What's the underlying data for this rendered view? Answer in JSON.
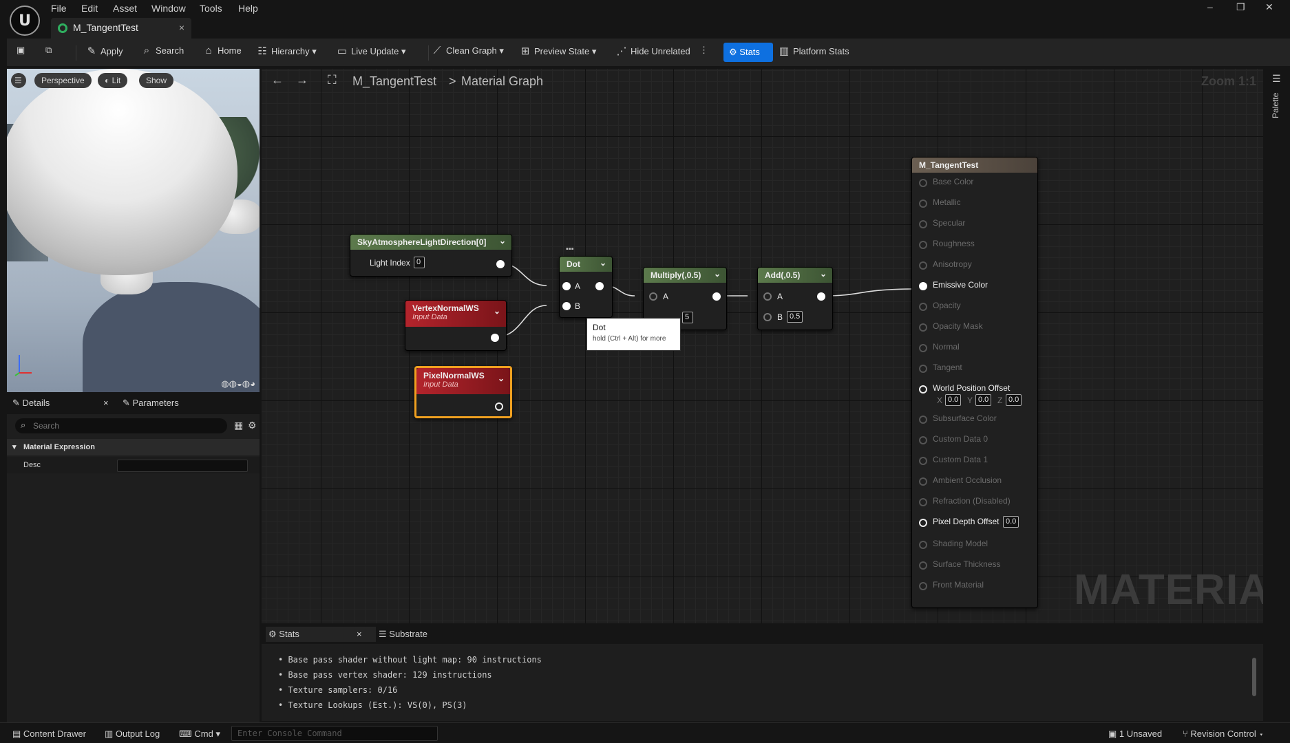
{
  "menu": [
    "File",
    "Edit",
    "Asset",
    "Window",
    "Tools",
    "Help"
  ],
  "tab": {
    "title": "M_TangentTest",
    "close": "×"
  },
  "window_controls": {
    "min": "–",
    "max": "❐",
    "close": "✕"
  },
  "toolbar": {
    "apply": "Apply",
    "search": "Search",
    "home": "Home",
    "hierarchy": "Hierarchy",
    "live_update": "Live Update",
    "clean_graph": "Clean Graph",
    "preview_state": "Preview State",
    "hide_unrelated": "Hide Unrelated",
    "stats": "Stats",
    "platform_stats": "Platform Stats"
  },
  "viewport": {
    "perspective": "Perspective",
    "lit": "Lit",
    "show": "Show"
  },
  "details": {
    "tab_details": "Details",
    "tab_parameters": "Parameters",
    "search_placeholder": "Search",
    "section": "Material Expression",
    "desc_label": "Desc",
    "desc_value": ""
  },
  "graph": {
    "crumb_asset": "M_TangentTest",
    "crumb_sep": ">",
    "crumb_graph": "Material Graph",
    "zoom": "Zoom 1:1",
    "watermark": "MATERIAL"
  },
  "nodes": {
    "sky": {
      "title": "SkyAtmosphereLightDirection[0]",
      "pin": "Light Index",
      "value": "0"
    },
    "vertex": {
      "title": "VertexNormalWS",
      "subtitle": "Input Data"
    },
    "pixel": {
      "title": "PixelNormalWS",
      "subtitle": "Input Data"
    },
    "dot": {
      "title": "Dot",
      "a": "A",
      "b": "B"
    },
    "multiply": {
      "title": "Multiply(,0.5)",
      "a": "A",
      "b_value": "5"
    },
    "add": {
      "title": "Add(,0.5)",
      "a": "A",
      "b": "B",
      "b_value": "0.5"
    }
  },
  "tooltip": {
    "title": "Dot",
    "hint": "hold (Ctrl + Alt) for more"
  },
  "material_node": {
    "title": "M_TangentTest",
    "inputs": [
      "Base Color",
      "Metallic",
      "Specular",
      "Roughness",
      "Anisotropy",
      "Emissive Color",
      "Opacity",
      "Opacity Mask",
      "Normal",
      "Tangent",
      "World Position Offset",
      "Subsurface Color",
      "Custom Data 0",
      "Custom Data 1",
      "Ambient Occlusion",
      "Refraction (Disabled)",
      "Pixel Depth Offset",
      "Shading Model",
      "Surface Thickness",
      "Front Material"
    ],
    "wpo": {
      "x_label": "X",
      "x": "0.0",
      "y_label": "Y",
      "y": "0.0",
      "z_label": "Z",
      "z": "0.0"
    },
    "pdo": "0.0"
  },
  "palette": "Palette",
  "stats_panel": {
    "tab_stats": "Stats",
    "tab_substrate": "Substrate",
    "lines": [
      "Base pass shader without light map: 90 instructions",
      "Base pass vertex shader: 129 instructions",
      "Texture samplers: 0/16",
      "Texture Lookups (Est.): VS(0), PS(3)"
    ]
  },
  "statusbar": {
    "content_drawer": "Content Drawer",
    "output_log": "Output Log",
    "cmd": "Cmd",
    "console_placeholder": "Enter Console Command",
    "unsaved": "1 Unsaved",
    "revision": "Revision Control"
  }
}
